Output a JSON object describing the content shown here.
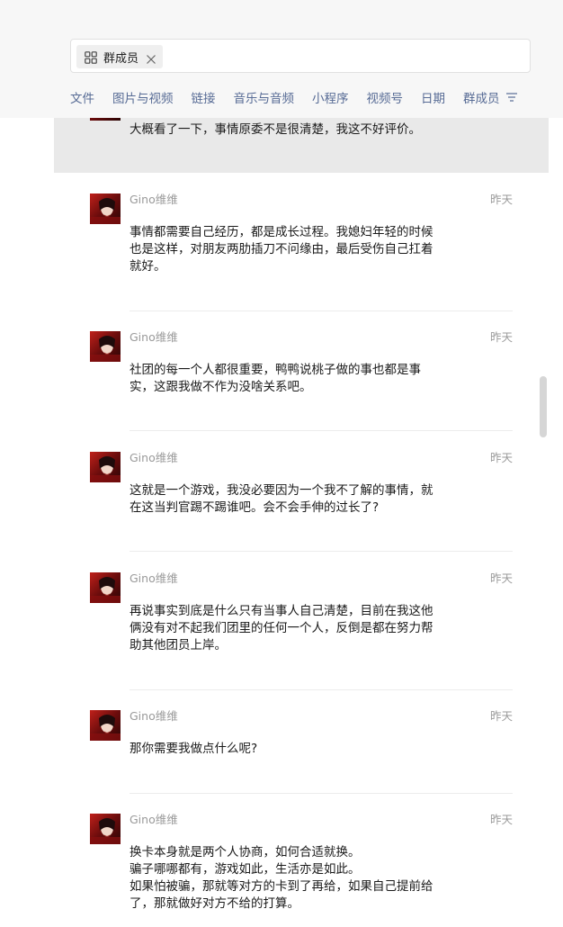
{
  "header": {
    "filter_chip": {
      "label": "群成员"
    },
    "tabs": [
      {
        "label": "文件"
      },
      {
        "label": "图片与视频"
      },
      {
        "label": "链接"
      },
      {
        "label": "音乐与音频"
      },
      {
        "label": "小程序"
      },
      {
        "label": "视频号"
      },
      {
        "label": "日期"
      },
      {
        "label": "群成员"
      }
    ]
  },
  "highlight": {
    "content": "大概看了一下，事情原委不是很清楚，我这不好评价。"
  },
  "messages": [
    {
      "sender": "Gino维维",
      "time": "昨天",
      "content": "事情都需要自己经历，都是成长过程。我媳妇年轻的时候\n也是这样，对朋友两肋插刀不问缘由，最后受伤自己扛着\n就好。"
    },
    {
      "sender": "Gino维维",
      "time": "昨天",
      "content": "社团的每一个人都很重要，鸭鸭说桃子做的事也都是事\n实，这跟我做不作为没啥关系吧。"
    },
    {
      "sender": "Gino维维",
      "time": "昨天",
      "content": "这就是一个游戏，我没必要因为一个我不了解的事情，就\n在这当判官踢不踢谁吧。会不会手伸的过长了?"
    },
    {
      "sender": "Gino维维",
      "time": "昨天",
      "content": "再说事实到底是什么只有当事人自己清楚，目前在我这他\n俩没有对不起我们团里的任何一个人，反倒是都在努力帮\n助其他团员上岸。"
    },
    {
      "sender": "Gino维维",
      "time": "昨天",
      "content": "那你需要我做点什么呢?"
    },
    {
      "sender": "Gino维维",
      "time": "昨天",
      "content": "换卡本身就是两个人协商，如何合适就换。\n骗子哪哪都有，游戏如此，生活亦是如此。\n如果怕被骗，那就等对方的卡到了再给，如果自己提前给\n了，那就做好对方不给的打算。"
    }
  ]
}
